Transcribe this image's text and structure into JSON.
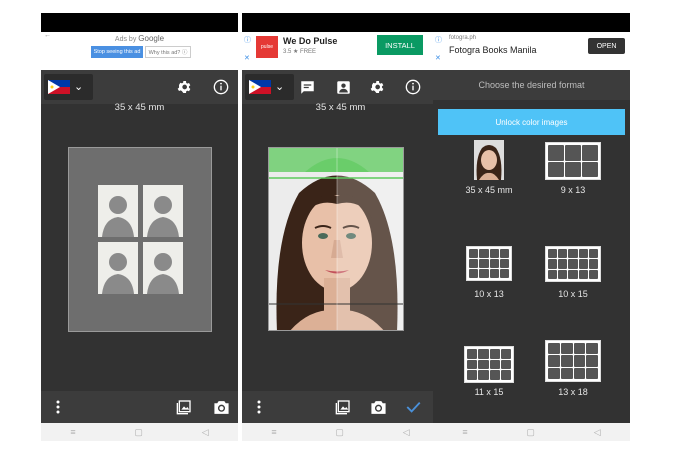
{
  "screen1": {
    "ad": {
      "brand_prefix": "Ads by",
      "brand": "Google",
      "stop_label": "Stop seeing this ad",
      "why_label": "Why this ad? ⓘ"
    },
    "size_label": "35 x 45 mm"
  },
  "screen2": {
    "ad": {
      "logo_text": "pulse",
      "title": "We Do Pulse",
      "rating": "3.5 ★ FREE",
      "install_label": "INSTALL"
    },
    "size_label": "35 x 45 mm"
  },
  "screen3": {
    "ad": {
      "domain": "fotogra.ph",
      "title": "Fotogra Books Manila",
      "open_label": "OPEN"
    },
    "prompt": "Choose the desired format",
    "unlock_label": "Unlock color images",
    "formats": [
      "35 x 45 mm",
      "9 x 13",
      "10 x 13",
      "10 x 15",
      "11 x 15",
      "13 x 18"
    ]
  },
  "colors": {
    "accent_blue": "#4fc3f7",
    "install_green": "#0a9a63",
    "check_blue": "#4a90d9",
    "guide_green": "#5cc95c"
  },
  "icons": [
    "flag-philippines-icon",
    "chevron-down-icon",
    "gear-icon",
    "info-icon",
    "chat-icon",
    "portrait-icon",
    "more-vert-icon",
    "gallery-icon",
    "camera-icon",
    "check-icon",
    "back-icon",
    "home-icon",
    "recents-icon"
  ]
}
